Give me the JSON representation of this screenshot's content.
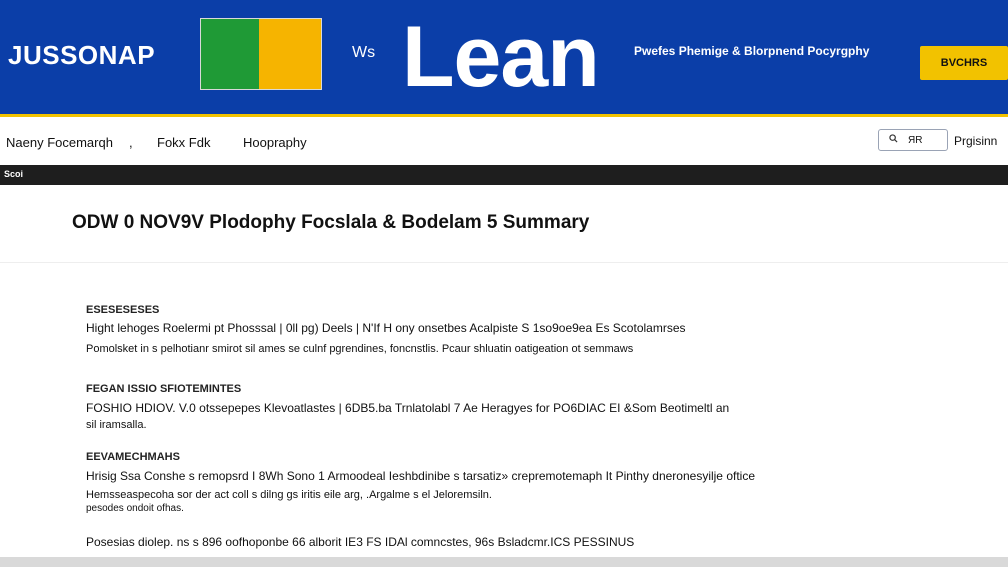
{
  "header": {
    "logo_text": "JUSSONAP",
    "connector_text": "Ws",
    "title": "Lean",
    "tagline": "Pwefes Phemige & Blorpnend Pocyrgphy",
    "cta_label": "BVCHRS",
    "flag_colors": [
      "#1f9a36",
      "#f6b400"
    ],
    "brand_color": "#0b3ea8",
    "accent_color": "#f2c200"
  },
  "nav": {
    "items": [
      "Naeny Focemarqh",
      "Fokx Fdk",
      "Hoopraphy"
    ],
    "search_label": "ЯR",
    "search_icon": "search-icon",
    "signin_label": "Prgisinn"
  },
  "subbar": {
    "label": "Scoi"
  },
  "page": {
    "title": "ODW 0 NOV9V Plodophy Focslala & Bodelam 5 Summary"
  },
  "sections": [
    {
      "label": "ESESESESES",
      "lines": [
        "Hight lehoges Roelermi pt Phosssal | 0ll pg) Deels | N'If H ony onsetbes Acalpiste S 1so9oe9ea Es Scotolamrses",
        "Pomolsket in s pelhotianr smirot sil ames se culnf pgrendines, foncnstlis. Pcaur shluatin oatigeation ot semmaws"
      ]
    },
    {
      "label": "FEGAN ISSIO SFIOTEMINTES",
      "lines": [
        "FOSHIO HDIOV. V.0 otssepepes Klevoatlastes | 6DB5.ba Trnlatolabl 7 Ae Heragyes for PO6DIAC EI &Som Beotimeltl an",
        "sil iramsalla."
      ]
    },
    {
      "label": "EEVAMECHMAHS",
      "lines": [
        "Hrisig Ssa Conshe s remopsrd I 8Wh Sono 1 Armoodeal Ieshbdinibe s tarsatiz» crepremotemaph It Pinthy dneronesyilje oftice",
        "Hemsseaspecoha sor der act coll s dilng gs iritis eile arg, .Argalme s el Jeloremsiln.",
        "pesodes ondoit ofhas."
      ]
    },
    {
      "label": "",
      "lines": [
        "Posesias diolep. ns s 896 oofhoponbe 66 alborit IE3 FS IDAl comncstes, 96s Bsladcmr.ICS PESSINUS"
      ]
    }
  ]
}
